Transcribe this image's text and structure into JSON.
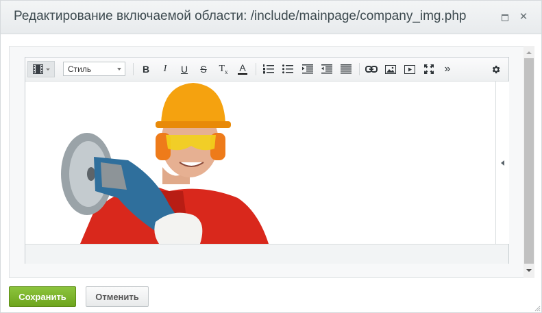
{
  "dialog": {
    "title": "Редактирование включаемой области: /include/mainpage/company_img.php"
  },
  "toolbar": {
    "style_select": "Стиль",
    "buttons": [
      {
        "name": "bold-button",
        "glyph": "B"
      },
      {
        "name": "italic-button",
        "glyph": "I"
      },
      {
        "name": "underline-button",
        "glyph": "U"
      },
      {
        "name": "strikethrough-button",
        "glyph": "S"
      },
      {
        "name": "remove-format-button",
        "glyph": "Tx"
      },
      {
        "name": "font-color-button",
        "glyph": "A"
      }
    ],
    "colors": {
      "font_color_underline": "#000000"
    }
  },
  "editor": {
    "image": {
      "name": "worker-photo",
      "description_icon": "worker-with-grinder-photo"
    }
  },
  "actions": {
    "save_label": "Сохранить",
    "cancel_label": "Отменить"
  },
  "colors": {
    "save_button": "#7bb42a",
    "title_text": "#3d4a4f"
  }
}
